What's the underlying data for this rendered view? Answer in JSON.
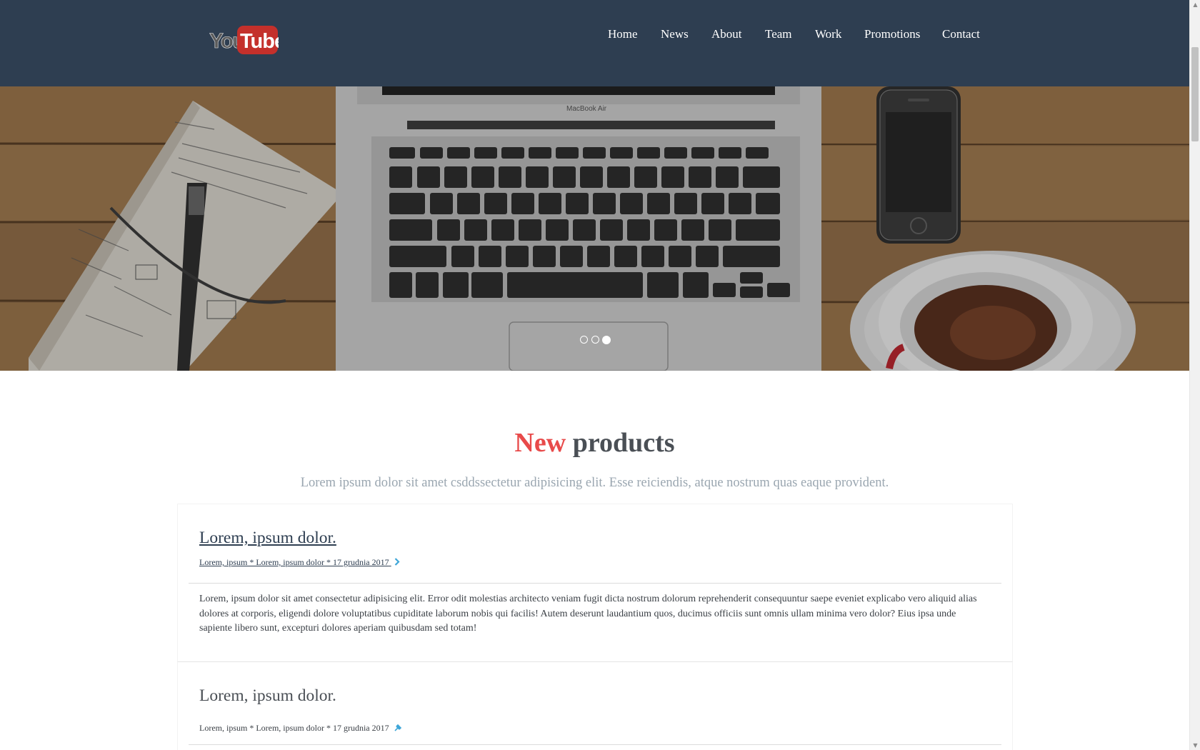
{
  "header": {
    "logo": {
      "text_you": "You",
      "text_tube": "Tube",
      "icon": "youtube-logo"
    },
    "nav": [
      "Home",
      "News",
      "About",
      "Team",
      "Work",
      "Promotions",
      "Contact"
    ]
  },
  "hero": {
    "laptop_label": "MacBook Air",
    "slides_total": 3,
    "active_slide": 3
  },
  "section": {
    "title_accent": "New",
    "title_rest": "products",
    "subtitle": "Lorem ipsum dolor sit amet csddssectetur adipisicing elit. Esse reiciendis, atque nostrum quas eaque provident."
  },
  "posts": [
    {
      "title": "Lorem, ipsum dolor.",
      "meta": "Lorem, ipsum * Lorem, ipsum dolor * 17 grudnia 2017",
      "meta_icon": "chevron-right-icon",
      "body": "Lorem, ipsum dolor sit amet consectetur adipisicing elit. Error odit molestias architecto veniam fugit dicta nostrum dolorum reprehenderit consequuntur saepe eveniet explicabo vero aliquid alias dolores at corporis, eligendi dolore voluptatibus cupiditate laborum nobis qui facilis! Autem deserunt laudantium quos, ducimus officiis sunt omnis ullam minima vero dolor? Eius ipsa unde sapiente libero sunt, excepturi dolores aperiam quibusdam sed totam!"
    },
    {
      "title": "Lorem, ipsum dolor.",
      "meta": "Lorem, ipsum * Lorem, ipsum dolor * 17 grudnia 2017",
      "meta_icon": "pin-icon"
    }
  ],
  "colors": {
    "header_bg": "#2e3e51",
    "accent_red": "#e84a4a",
    "icon_blue": "#3ea6d8"
  }
}
